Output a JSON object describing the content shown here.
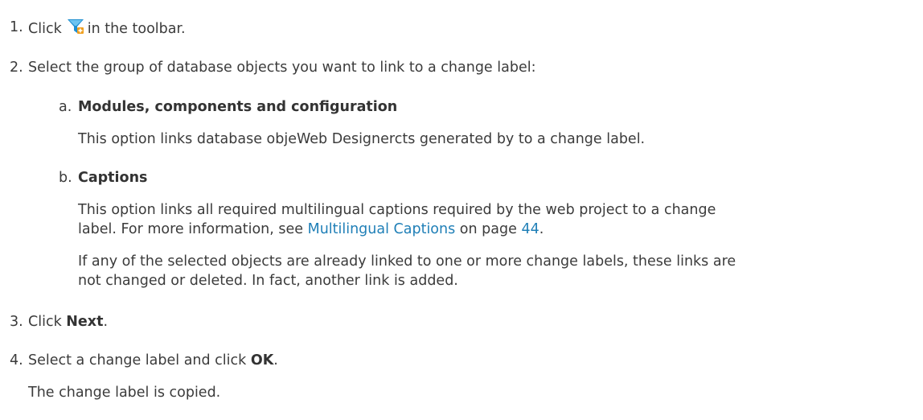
{
  "steps": [
    {
      "num": "1.",
      "pre": "Click",
      "icon": "filter-add-icon",
      "post": "in the toolbar."
    },
    {
      "num": "2.",
      "text": "Select the group of database objects you want to link to a change label:"
    },
    {
      "num": "3.",
      "pre": "Click ",
      "bold": "Next",
      "post": "."
    },
    {
      "num": "4.",
      "pre": "Select a change label and click ",
      "bold": "OK",
      "post": ".",
      "result": "The change label is copied."
    }
  ],
  "sub_items": [
    {
      "letter": "a.",
      "title": "Modules, components and configuration",
      "desc": "This option links database objeWeb Designercts generated by to a change label."
    },
    {
      "letter": "b.",
      "title": "Captions",
      "desc_line1": "This option links all required multilingual captions required by the web project to a change",
      "desc_line2_pre": "label. For more information, see ",
      "desc_link": "Multilingual Captions",
      "desc_mid": " on page ",
      "desc_page": "44",
      "desc_end": ".",
      "note_line1": "If any of the selected objects are already linked to one or more change labels, these links are",
      "note_line2": "not changed or deleted. In fact, another link is added."
    }
  ],
  "colors": {
    "text": "#3b3b3b",
    "link": "#1f7fb7",
    "icon_blue": "#1f8fd0",
    "icon_accent": "#f0a020"
  }
}
